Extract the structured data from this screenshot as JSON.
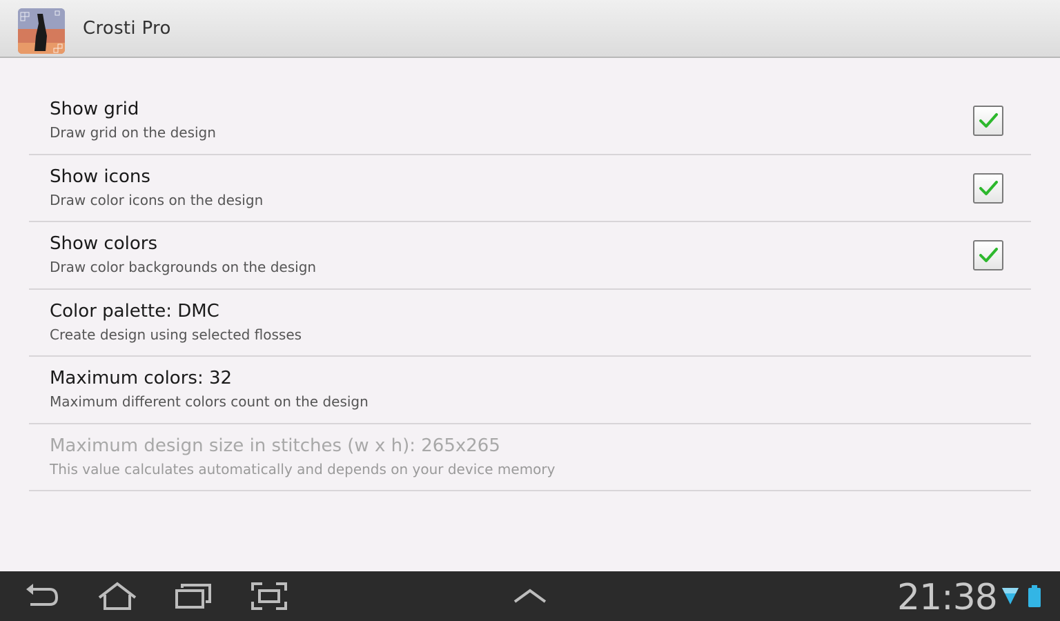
{
  "app": {
    "title": "Crosti Pro",
    "icon": "crosti-app-icon"
  },
  "preferences": [
    {
      "title": "Show grid",
      "summary": "Draw grid on the design",
      "checked": true
    },
    {
      "title": "Show icons",
      "summary": "Draw color icons on the design",
      "checked": true
    },
    {
      "title": "Show colors",
      "summary": "Draw color backgrounds on the design",
      "checked": true
    },
    {
      "title": "Color palette: DMC",
      "summary": "Create design using selected flosses"
    },
    {
      "title": "Maximum colors: 32",
      "summary": "Maximum different colors count on the design"
    },
    {
      "title": "Maximum design size in stitches (w x h): 265x265",
      "summary": "This value calculates automatically and depends on your device memory",
      "enabled": false
    }
  ],
  "nav_bar": {
    "buttons": [
      "back-icon",
      "home-icon",
      "recent-apps-icon",
      "screenshot-icon",
      "chevron-up-icon"
    ],
    "clock": "21:38",
    "status_icons": [
      "wifi-icon",
      "battery-icon"
    ]
  },
  "colors": {
    "check_mark": "#2db82d",
    "status_accent": "#33b5e5"
  }
}
